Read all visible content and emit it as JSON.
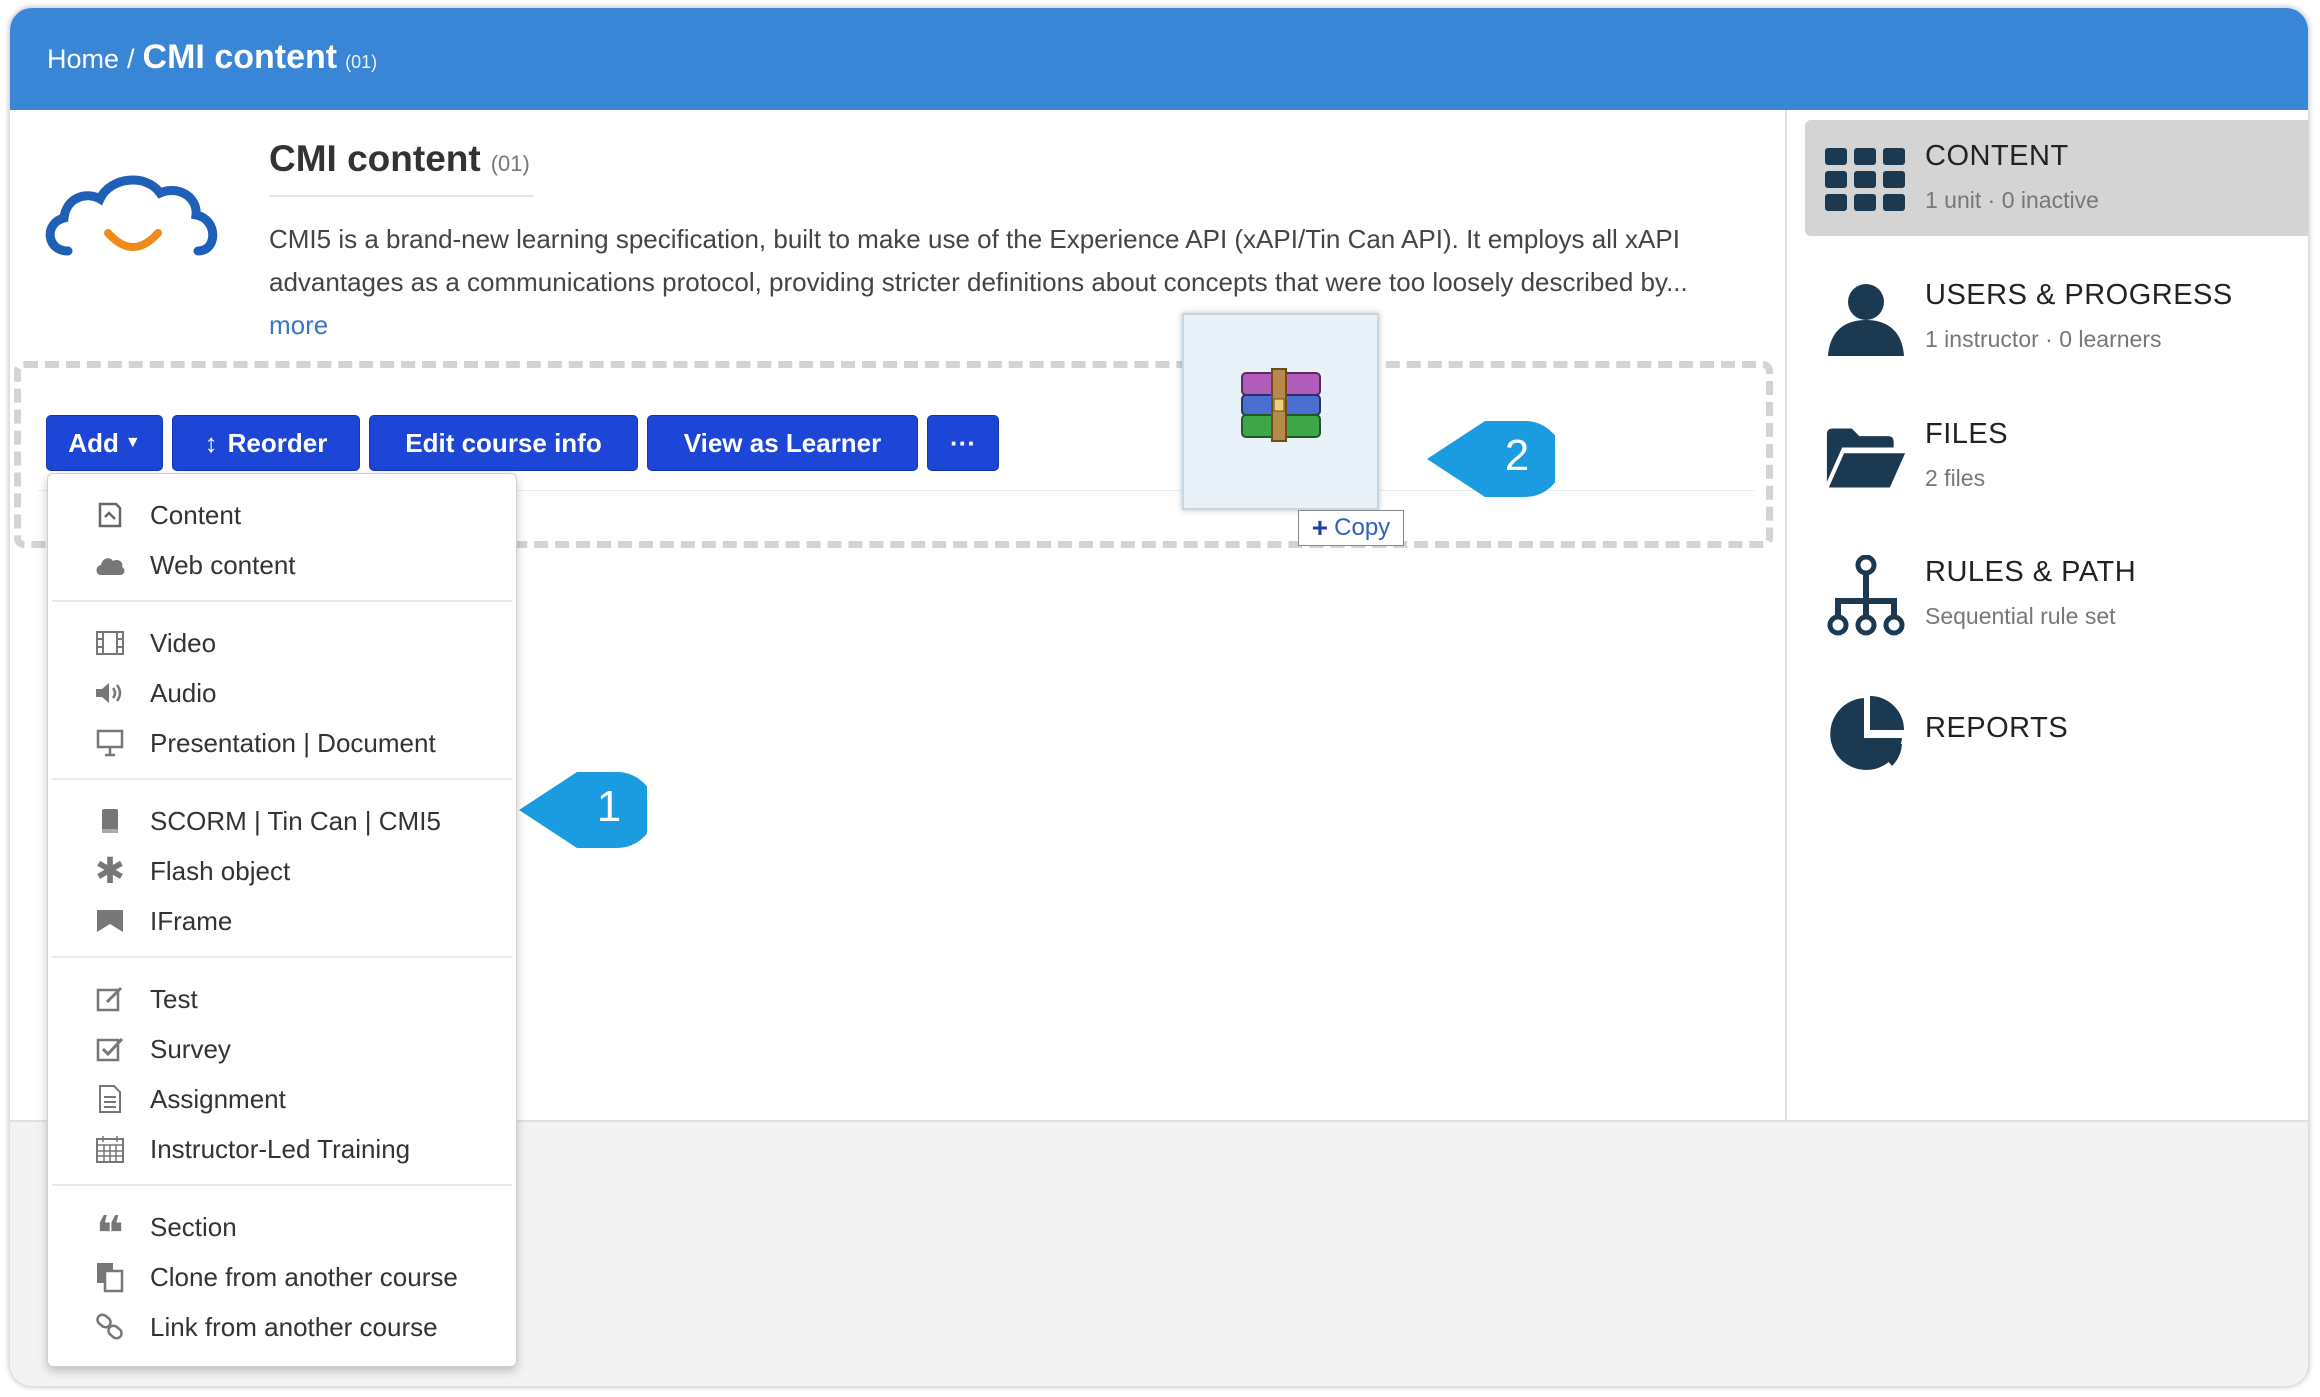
{
  "breadcrumb": {
    "home": "Home",
    "sep": "/",
    "current": "CMI content",
    "code": "(01)"
  },
  "course": {
    "title": "CMI content",
    "code": "(01)",
    "description": "CMI5 is a brand-new learning specification, built to make use of the Experience API (xAPI/Tin Can API). It employs all xAPI advantages as a communications protocol, providing stricter definitions about concepts that were too loosely described by...",
    "more": "more"
  },
  "toolbar": {
    "add": "Add",
    "reorder": "Reorder",
    "edit": "Edit course info",
    "view": "View as Learner",
    "more": "···"
  },
  "drag": {
    "copy_label": "Copy",
    "icon": "winrar-archive-icon"
  },
  "add_menu": {
    "groups": [
      [
        {
          "label": "Content",
          "icon": "content-icon"
        },
        {
          "label": "Web content",
          "icon": "cloud-icon"
        }
      ],
      [
        {
          "label": "Video",
          "icon": "film-icon"
        },
        {
          "label": "Audio",
          "icon": "speaker-icon"
        },
        {
          "label": "Presentation | Document",
          "icon": "presentation-icon"
        }
      ],
      [
        {
          "label": "SCORM | Tin Can | CMI5",
          "icon": "package-icon"
        },
        {
          "label": "Flash object",
          "icon": "asterisk-icon"
        },
        {
          "label": "IFrame",
          "icon": "iframe-icon"
        }
      ],
      [
        {
          "label": "Test",
          "icon": "edit-icon"
        },
        {
          "label": "Survey",
          "icon": "checkbox-icon"
        },
        {
          "label": "Assignment",
          "icon": "document-icon"
        },
        {
          "label": "Instructor-Led Training",
          "icon": "calendar-icon"
        }
      ],
      [
        {
          "label": "Section",
          "icon": "quote-icon"
        },
        {
          "label": "Clone from another course",
          "icon": "clone-icon"
        },
        {
          "label": "Link from another course",
          "icon": "link-icon"
        }
      ]
    ]
  },
  "callouts": {
    "one": "1",
    "two": "2",
    "color": "#1b9be0"
  },
  "sidebar": {
    "items": [
      {
        "title": "CONTENT",
        "subtitle": "1 unit · 0 inactive",
        "icon": "grid-icon",
        "active": true
      },
      {
        "title": "USERS & PROGRESS",
        "subtitle": "1 instructor · 0 learners",
        "icon": "user-icon"
      },
      {
        "title": "FILES",
        "subtitle": "2 files",
        "icon": "folder-icon"
      },
      {
        "title": "RULES & PATH",
        "subtitle": "Sequential rule set",
        "icon": "sitemap-icon"
      },
      {
        "title": "REPORTS",
        "subtitle": "",
        "icon": "pie-chart-icon"
      }
    ]
  },
  "colors": {
    "topbar": "#3a86d6",
    "button": "#1e46d6",
    "sidebar_icon": "#1b3a52",
    "link": "#3a76c6"
  }
}
